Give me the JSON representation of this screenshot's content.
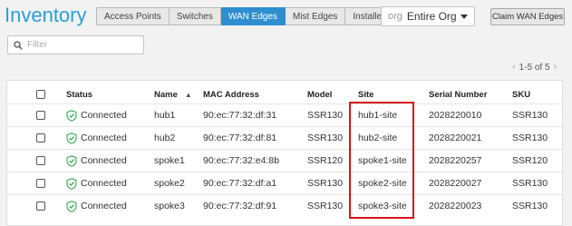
{
  "page": {
    "title": "Inventory"
  },
  "tabs": [
    {
      "label": "Access Points",
      "active": false
    },
    {
      "label": "Switches",
      "active": false
    },
    {
      "label": "WAN Edges",
      "active": true
    },
    {
      "label": "Mist Edges",
      "active": false
    },
    {
      "label": "Installed Base",
      "active": false
    }
  ],
  "org_select": {
    "prefix": "org",
    "value": "Entire Org"
  },
  "claim_button": {
    "label": "Claim WAN Edges"
  },
  "filter": {
    "placeholder": "Filter"
  },
  "pagination": {
    "range": "1-5 of 5"
  },
  "table": {
    "columns": [
      "Status",
      "Name",
      "MAC Address",
      "Model",
      "Site",
      "Serial Number",
      "SKU"
    ],
    "sorted_column": "Name",
    "rows": [
      {
        "status": "Connected",
        "name": "hub1",
        "mac": "90:ec:77:32:df:31",
        "model": "SSR130",
        "site": "hub1-site",
        "serial": "2028220010",
        "sku": "SSR130"
      },
      {
        "status": "Connected",
        "name": "hub2",
        "mac": "90:ec:77:32:df:81",
        "model": "SSR130",
        "site": "hub2-site",
        "serial": "2028220021",
        "sku": "SSR130"
      },
      {
        "status": "Connected",
        "name": "spoke1",
        "mac": "90:ec:77:32:e4:8b",
        "model": "SSR120",
        "site": "spoke1-site",
        "serial": "2028220257",
        "sku": "SSR120"
      },
      {
        "status": "Connected",
        "name": "spoke2",
        "mac": "90:ec:77:32:df:a1",
        "model": "SSR130",
        "site": "spoke2-site",
        "serial": "2028220027",
        "sku": "SSR130"
      },
      {
        "status": "Connected",
        "name": "spoke3",
        "mac": "90:ec:77:32:df:91",
        "model": "SSR130",
        "site": "spoke3-site",
        "serial": "2028220023",
        "sku": "SSR130"
      }
    ]
  },
  "colors": {
    "title": "#2a9fd8",
    "active_tab": "#2f8ed0",
    "connected_icon": "#3aa650",
    "highlight": "#d7141b"
  },
  "icons": {
    "filter": "search-icon",
    "status": "shield-check-icon",
    "sort": "sort-arrow-icon",
    "pager_prev": "chevron-left-icon",
    "pager_next": "chevron-right-icon",
    "org_select": "caret-down-icon"
  }
}
